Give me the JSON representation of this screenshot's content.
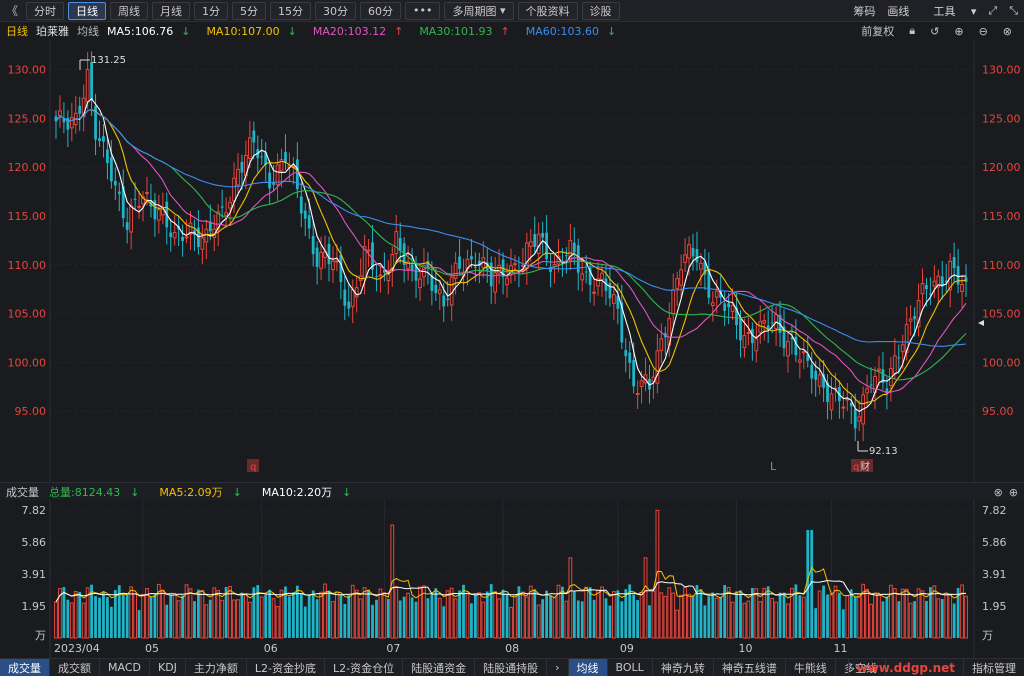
{
  "toolbar": {
    "back_icon": "《",
    "period_tabs": [
      "分时",
      "日线",
      "周线",
      "月线",
      "1分",
      "5分",
      "15分",
      "30分",
      "60分"
    ],
    "active_period": "日线",
    "more_label": "•••",
    "multi_period_label": "多周期图",
    "stock_info_label": "个股资料",
    "diagnose_label": "诊股",
    "right_items": [
      "筹码",
      "画线",
      "工具"
    ]
  },
  "indicators": {
    "period": "日线",
    "stock_name": "珀莱雅",
    "ma_label": "均线",
    "ma5": "MA5:106.76",
    "ma10": "MA10:107.00",
    "ma20": "MA20:103.12",
    "ma30": "MA30:101.93",
    "ma60": "MA60:103.60",
    "adjust_label": "前复权",
    "colors": {
      "ma5": "#ffffff",
      "ma10": "#f2c200",
      "ma20": "#e055c0",
      "ma30": "#2fb84e",
      "ma60": "#3a8df0",
      "up": "#e8453c",
      "down": "#1fb5c8"
    }
  },
  "price_axis": {
    "ticks": [
      "130.00",
      "125.00",
      "120.00",
      "115.00",
      "110.00",
      "105.00",
      "100.00",
      "95.00"
    ]
  },
  "annotations": {
    "high": "131.25",
    "low": "92.13",
    "marker_left": "q",
    "marker_mid": "L",
    "marker_right_a": "q",
    "marker_right_b": "财"
  },
  "volume": {
    "title": "成交量",
    "total": "总量:8124.43",
    "ma5": "MA5:2.09万",
    "ma10": "MA10:2.20万",
    "axis_ticks": [
      "7.82",
      "5.86",
      "3.91",
      "1.95",
      "万"
    ],
    "x_labels": [
      "2023/04",
      "05",
      "06",
      "07",
      "08",
      "09",
      "10",
      "11"
    ]
  },
  "bottom_tabs_left": [
    "成交量",
    "成交额",
    "MACD",
    "KDJ",
    "主力净额",
    "L2-资金抄底",
    "L2-资金仓位",
    "陆股通资金",
    "陆股通持股"
  ],
  "bottom_tabs_right": [
    "均线",
    "BOLL",
    "神奇九转",
    "神奇五线谱",
    "牛熊线",
    "多空线",
    "指标管理"
  ],
  "watermark": "www.ddgp.net",
  "chart_data": {
    "type": "candlestick",
    "title": "",
    "y_range": [
      90,
      132
    ],
    "volume_range": [
      0,
      7.82
    ],
    "volume_unit": "万",
    "close_points": [
      {
        "i": 0,
        "c": 124
      },
      {
        "i": 5,
        "c": 125.5
      },
      {
        "i": 8,
        "c": 129
      },
      {
        "i": 10,
        "c": 123
      },
      {
        "i": 14,
        "c": 120
      },
      {
        "i": 18,
        "c": 114
      },
      {
        "i": 22,
        "c": 117
      },
      {
        "i": 26,
        "c": 116
      },
      {
        "i": 30,
        "c": 112
      },
      {
        "i": 34,
        "c": 114
      },
      {
        "i": 38,
        "c": 112.5
      },
      {
        "i": 42,
        "c": 115
      },
      {
        "i": 46,
        "c": 120
      },
      {
        "i": 50,
        "c": 122
      },
      {
        "i": 54,
        "c": 119
      },
      {
        "i": 58,
        "c": 121
      },
      {
        "i": 62,
        "c": 116
      },
      {
        "i": 66,
        "c": 111
      },
      {
        "i": 70,
        "c": 110
      },
      {
        "i": 74,
        "c": 106
      },
      {
        "i": 78,
        "c": 111
      },
      {
        "i": 82,
        "c": 108
      },
      {
        "i": 86,
        "c": 113
      },
      {
        "i": 90,
        "c": 108
      },
      {
        "i": 94,
        "c": 110
      },
      {
        "i": 98,
        "c": 105.5
      },
      {
        "i": 102,
        "c": 110
      },
      {
        "i": 106,
        "c": 111
      },
      {
        "i": 110,
        "c": 108
      },
      {
        "i": 114,
        "c": 110
      },
      {
        "i": 118,
        "c": 110
      },
      {
        "i": 122,
        "c": 113
      },
      {
        "i": 126,
        "c": 110
      },
      {
        "i": 130,
        "c": 111
      },
      {
        "i": 134,
        "c": 109
      },
      {
        "i": 138,
        "c": 108
      },
      {
        "i": 142,
        "c": 105
      },
      {
        "i": 146,
        "c": 98
      },
      {
        "i": 150,
        "c": 97
      },
      {
        "i": 154,
        "c": 104
      },
      {
        "i": 158,
        "c": 110
      },
      {
        "i": 162,
        "c": 111
      },
      {
        "i": 166,
        "c": 107
      },
      {
        "i": 170,
        "c": 105
      },
      {
        "i": 174,
        "c": 103
      },
      {
        "i": 178,
        "c": 103
      },
      {
        "i": 182,
        "c": 104
      },
      {
        "i": 186,
        "c": 102
      },
      {
        "i": 190,
        "c": 99
      },
      {
        "i": 194,
        "c": 98
      },
      {
        "i": 198,
        "c": 96
      },
      {
        "i": 202,
        "c": 94
      },
      {
        "i": 206,
        "c": 99
      },
      {
        "i": 210,
        "c": 97
      },
      {
        "i": 214,
        "c": 103
      },
      {
        "i": 218,
        "c": 106
      },
      {
        "i": 222,
        "c": 108
      },
      {
        "i": 226,
        "c": 110
      },
      {
        "i": 230,
        "c": 106.7
      }
    ]
  }
}
